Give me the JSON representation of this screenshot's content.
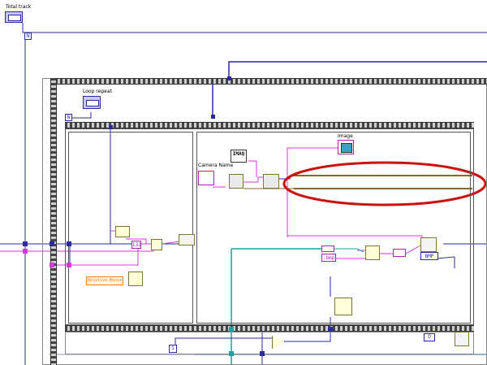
{
  "labels": {
    "total_track": "Total track",
    "loop_repeat": "Loop repeat",
    "camera_name": "Camera Name",
    "imaq": "IMAQ",
    "image": "Image",
    "relative_mouse": "Relative Mouse",
    "bmp_constant": ".bmp",
    "bmp_ring": "BMP",
    "numeric_zero": "0",
    "numeric_one": "1",
    "i32_value": "I32",
    "n_terminal": "N"
  },
  "colors": {
    "wire_blue": "#2a2aa0",
    "wire_pink": "#d63ad6",
    "wire_teal": "#229f9f",
    "wire_brown": "#8a6a2a",
    "highlight_red": "#cc1111",
    "frame_gray": "#888888"
  }
}
